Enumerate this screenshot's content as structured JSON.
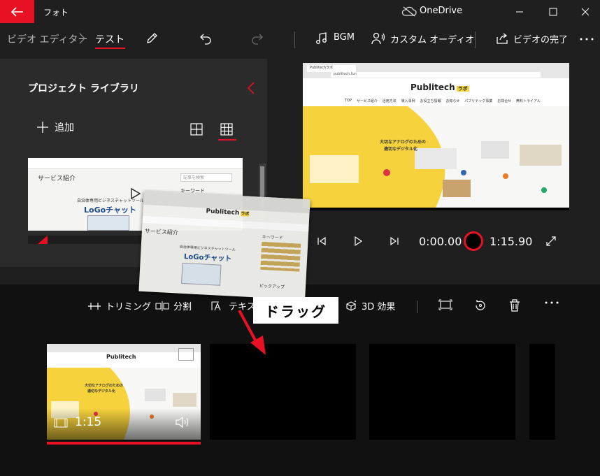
{
  "window": {
    "app_title": "フォト",
    "cloud_label": "OneDrive"
  },
  "toolbar": {
    "breadcrumb_parent": "ビデオ エディター",
    "breadcrumb_current": "テスト",
    "bgm_label": "BGM",
    "custom_audio_label": "カスタム オーディオ",
    "finish_label": "ビデオの完了"
  },
  "library": {
    "title": "プロジェクト ライブラリ",
    "add_label": "追加",
    "thumb_heading": "サービス紹介",
    "thumb_keyword": "キーワード",
    "thumb_product": "LoGoチャット",
    "thumb_tagline": "自治体専用ビジネスチャットツール",
    "thumb_search_placeholder": "記事を検索"
  },
  "drag_card": {
    "brand": "Publitech",
    "brand_tag": "ラボ",
    "section": "サービス紹介",
    "tagline": "自治体専用ビジネスチャットツール",
    "product": "LoGoチャット",
    "keyword": "キーワード",
    "pickup": "ピックアップ"
  },
  "preview": {
    "tab_label": "Publitechラボ",
    "url": "publitech.fun",
    "brand": "Publitech",
    "brand_tag": "ラボ",
    "nav": [
      "TOP",
      "サービス紹介",
      "活用方法",
      "導入事例",
      "お役立ち情報",
      "お知らせ",
      "パブリテック事業",
      "お問合せ",
      "無料トライアル"
    ],
    "hero_line1": "大切なアナログのための",
    "hero_line2": "適切なデジタル化"
  },
  "player": {
    "current_time": "0:00.00",
    "total_time": "1:15.90"
  },
  "storyboard": {
    "trim_label": "トリミング",
    "split_label": "分割",
    "text_label": "テキスト",
    "effects_label": "3D 効果",
    "clip_duration": "1:15"
  },
  "annotation": {
    "drag_label": "ドラッグ"
  },
  "colors": {
    "accent": "#e81123",
    "bg_dark": "#1f1f1f",
    "panel": "#2b2b2b",
    "storyboard_bg": "#111111",
    "hero_yellow": "#f6d23c"
  }
}
